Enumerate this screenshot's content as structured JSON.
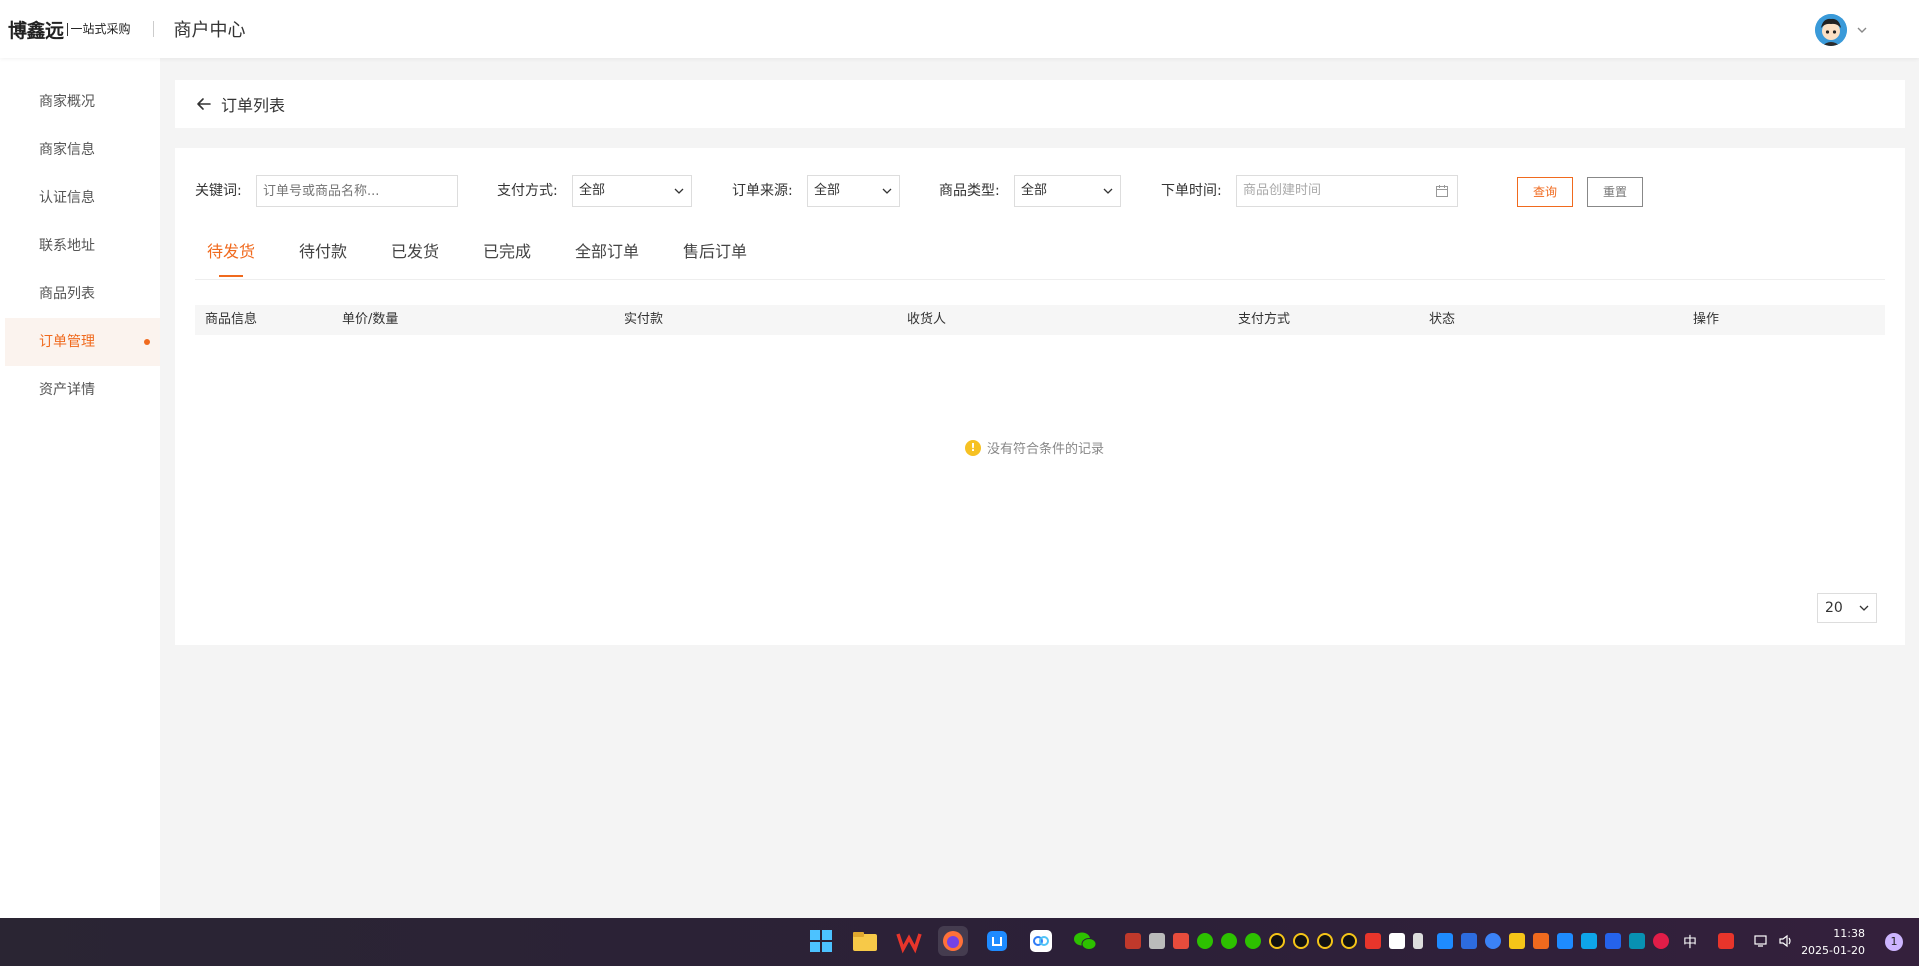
{
  "header": {
    "logo_main": "博鑫远",
    "logo_sub": "一站式采购",
    "title": "商户中心"
  },
  "sidebar": {
    "items": [
      {
        "label": "商家概况"
      },
      {
        "label": "商家信息"
      },
      {
        "label": "认证信息"
      },
      {
        "label": "联系地址"
      },
      {
        "label": "商品列表"
      },
      {
        "label": "订单管理",
        "active": true
      },
      {
        "label": "资产详情"
      }
    ]
  },
  "page": {
    "title": "订单列表"
  },
  "filters": {
    "keyword_label": "关键词:",
    "keyword_placeholder": "订单号或商品名称...",
    "payment_label": "支付方式:",
    "payment_value": "全部",
    "source_label": "订单来源:",
    "source_value": "全部",
    "type_label": "商品类型:",
    "type_value": "全部",
    "time_label": "下单时间:",
    "time_placeholder": "商品创建时间",
    "query_button": "查询",
    "reset_button": "重置"
  },
  "tabs": [
    {
      "label": "待发货",
      "active": true
    },
    {
      "label": "待付款"
    },
    {
      "label": "已发货"
    },
    {
      "label": "已完成"
    },
    {
      "label": "全部订单"
    },
    {
      "label": "售后订单"
    }
  ],
  "table": {
    "columns": [
      "商品信息",
      "单价/数量",
      "实付款",
      "收货人",
      "支付方式",
      "状态",
      "操作"
    ],
    "empty_text": "没有符合条件的记录"
  },
  "pagination": {
    "page_size": "20"
  },
  "taskbar": {
    "ime": "中",
    "time": "11:38",
    "date": "2025-01-20",
    "notifications": "1"
  },
  "colors": {
    "accent": "#f06a1e",
    "warning": "#f6c123"
  }
}
